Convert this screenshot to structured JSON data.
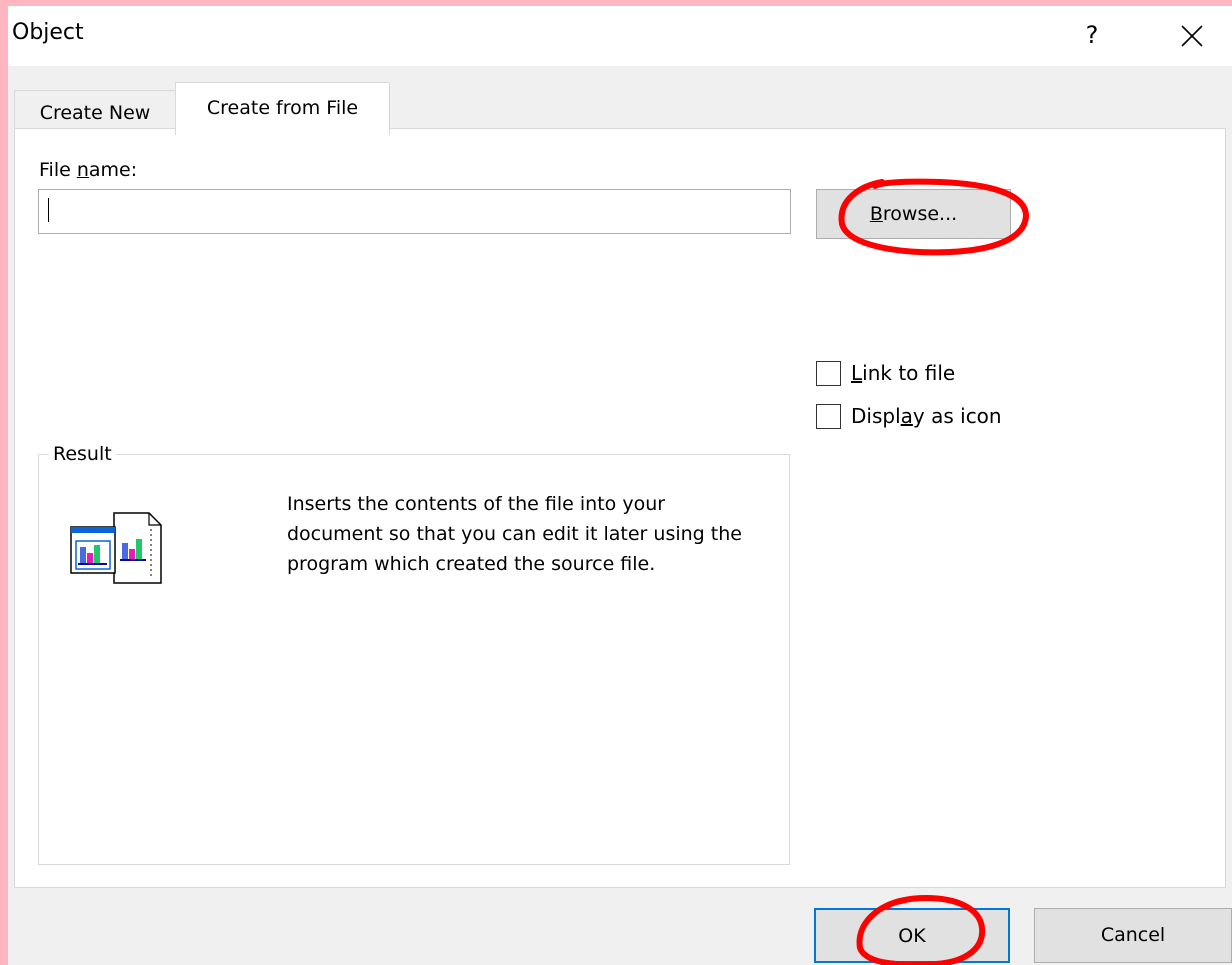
{
  "dialog": {
    "title": "Object",
    "help_label": "?"
  },
  "tabs": [
    {
      "label": "Create New"
    },
    {
      "label": "Create from File"
    }
  ],
  "file": {
    "label_pre": "File ",
    "label_mnemonic": "n",
    "label_post": "ame:",
    "value": "",
    "browse_mnemonic": "B",
    "browse_rest": "rowse..."
  },
  "options": {
    "link_mnemonic": "L",
    "link_rest": "ink to file",
    "display_pre": "Displ",
    "display_mnemonic": "a",
    "display_post": "y as icon"
  },
  "result": {
    "legend": "Result",
    "lines": [
      "Inserts the contents of the file into your",
      "document so that you can edit it later using the",
      "program which created the source file."
    ]
  },
  "buttons": {
    "ok": "OK",
    "cancel": "Cancel"
  },
  "colors": {
    "annotation": "#FF0000",
    "focus_border": "#0078D7",
    "background_frame": "#FFB6C1"
  },
  "icons": [
    "close-icon",
    "embedded-file-icon"
  ]
}
